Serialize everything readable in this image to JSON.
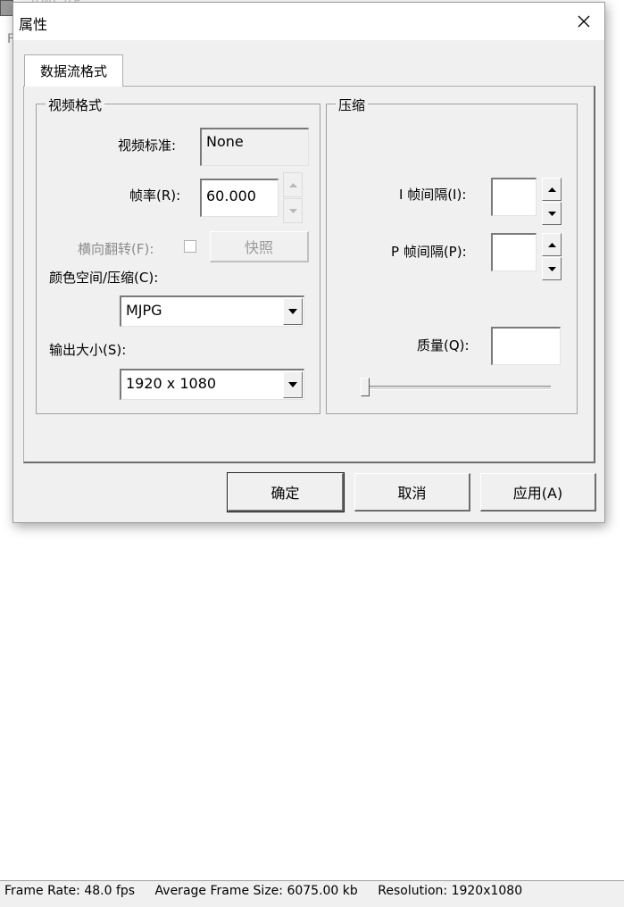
{
  "background_window": {
    "title": "AMCAP",
    "menu_letter": "F"
  },
  "dialog": {
    "title": "属性",
    "tab_label": "数据流格式",
    "video_format": {
      "group_title": "视频格式",
      "standard_label": "视频标准:",
      "standard_value": "None",
      "frame_rate_label": "帧率(R):",
      "frame_rate_value": "60.000",
      "flip_label": "横向翻转(F):",
      "snapshot_label": "快照",
      "color_space_label": "颜色空间/压缩(C):",
      "color_space_value": "MJPG",
      "output_size_label": "输出大小(S):",
      "output_size_value": "1920 x 1080"
    },
    "compression": {
      "group_title": "压缩",
      "i_frame_label": "I 帧间隔(I):",
      "i_frame_value": "",
      "p_frame_label": "P 帧间隔(P):",
      "p_frame_value": "",
      "quality_label": "质量(Q):",
      "quality_value": "",
      "quality_slider_fraction": 0
    },
    "buttons": {
      "ok": "确定",
      "cancel": "取消",
      "apply": "应用(A)"
    }
  },
  "statusbar": {
    "frame_rate": "Frame Rate: 48.0 fps",
    "avg_frame_size": "Average Frame Size: 6075.00 kb",
    "resolution": "Resolution: 1920x1080"
  },
  "icons": [
    "app-icon",
    "close-icon",
    "arrow-up-icon",
    "arrow-down-icon",
    "dropdown-arrow-icon"
  ]
}
